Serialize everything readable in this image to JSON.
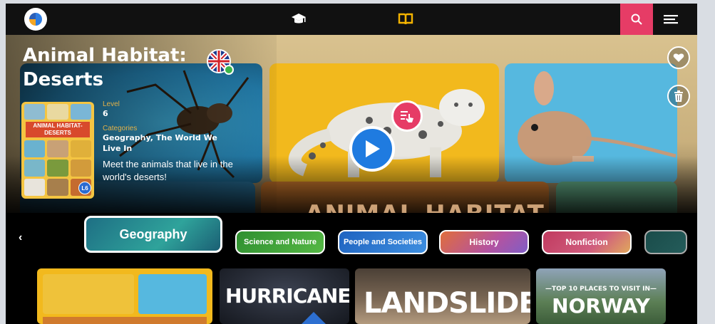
{
  "topbar": {
    "logo_icon": "globe-logo-icon",
    "courses_icon": "graduation-cap-icon",
    "library_icon": "open-book-icon",
    "search_icon": "search-icon",
    "menu_icon": "hamburger-menu-icon",
    "accent_color": "#e63c66",
    "library_color": "#f5b400"
  },
  "book": {
    "title_line1": "Animal Habitat:",
    "title_line2": "Deserts",
    "language_icon": "uk-flag-icon",
    "level_label": "Level",
    "level_value": "6",
    "categories_label": "Categories",
    "categories_value": "Geography, The World We Live In",
    "description": "Meet the animals that live in the world's deserts!",
    "cover_title": "ANIMAL HABITAT- DESERTS",
    "cover_badge": "L6",
    "banner_text": "ANIMAL HABITAT-"
  },
  "hero_actions": {
    "favorite_icon": "heart-icon",
    "delete_icon": "trash-icon",
    "play_icon": "play-icon",
    "read_icon": "read-touch-icon"
  },
  "carousel": {
    "dot_count": 5
  },
  "categories": [
    {
      "label": "Geography",
      "color": "#2e8f8a",
      "selected": true
    },
    {
      "label": "Science and Nature",
      "color": "#37a33b",
      "selected": false
    },
    {
      "label": "People and Societies",
      "color": "#2a6ec7",
      "selected": false
    },
    {
      "label": "History",
      "color": "#c4578c",
      "selected": false
    },
    {
      "label": "Nonfiction",
      "color": "#c63f6a",
      "selected": false
    }
  ],
  "shelf": {
    "book2": "HURRICANES",
    "book3": "LANDSLIDES",
    "book4_top": "—TOP 10 PLACES TO VISIT IN—",
    "book4_main": "NORWAY"
  },
  "nav": {
    "prev": "‹",
    "next": "›"
  }
}
